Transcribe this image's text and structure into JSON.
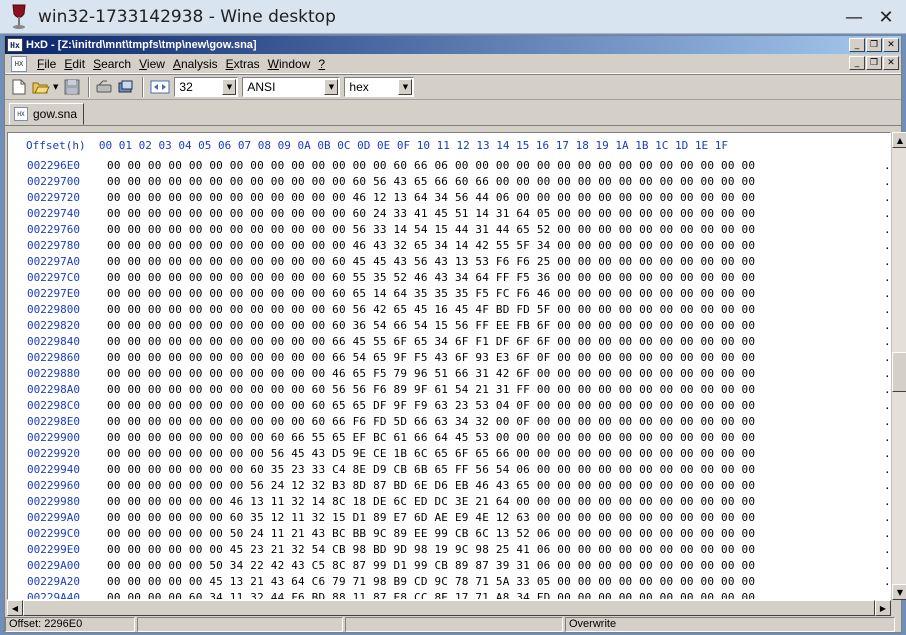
{
  "outer_window": {
    "title": "win32-1733142938 - Wine desktop"
  },
  "app": {
    "title": "HxD - [Z:\\initrd\\mnt\\tmpfs\\tmp\\new\\gow.sna]",
    "menu": [
      {
        "label": "File",
        "ul": "F",
        "rest": "ile"
      },
      {
        "label": "Edit",
        "ul": "E",
        "rest": "dit"
      },
      {
        "label": "Search",
        "ul": "S",
        "rest": "earch"
      },
      {
        "label": "View",
        "ul": "V",
        "rest": "iew"
      },
      {
        "label": "Analysis",
        "ul": "A",
        "rest": "nalysis"
      },
      {
        "label": "Extras",
        "ul": "E",
        "rest": "xtras"
      },
      {
        "label": "Window",
        "ul": "W",
        "rest": "indow"
      },
      {
        "label": "?",
        "ul": "?",
        "rest": ""
      }
    ],
    "toolbar": {
      "bytes_per_row": "32",
      "charset": "ANSI",
      "offset_base": "hex"
    },
    "tab": {
      "label": "gow.sna"
    },
    "hex_header": "Offset(h)  00 01 02 03 04 05 06 07 08 09 0A 0B 0C 0D 0E 0F 10 11 12 13 14 15 16 17 18 19 1A 1B 1C 1D 1E 1F",
    "rows": [
      {
        "offset": "002296E0",
        "bytes": "00 00 00 00 00 00 00 00 00 00 00 00 00 00 60 66 06 00 00 00 00 00 00 00 00 00 00 00 00 00 00 00",
        "ascii": "."
      },
      {
        "offset": "00229700",
        "bytes": "00 00 00 00 00 00 00 00 00 00 00 00 60 56 43 65 66 60 66 00 00 00 00 00 00 00 00 00 00 00 00 00",
        "ascii": "."
      },
      {
        "offset": "00229720",
        "bytes": "00 00 00 00 00 00 00 00 00 00 00 00 46 12 13 64 34 56 44 06 00 00 00 00 00 00 00 00 00 00 00 00",
        "ascii": "."
      },
      {
        "offset": "00229740",
        "bytes": "00 00 00 00 00 00 00 00 00 00 00 00 60 24 33 41 45 51 14 31 64 05 00 00 00 00 00 00 00 00 00 00",
        "ascii": "."
      },
      {
        "offset": "00229760",
        "bytes": "00 00 00 00 00 00 00 00 00 00 00 00 56 33 14 54 15 44 31 44 65 52 00 00 00 00 00 00 00 00 00 00",
        "ascii": "."
      },
      {
        "offset": "00229780",
        "bytes": "00 00 00 00 00 00 00 00 00 00 00 00 46 43 32 65 34 14 42 55 5F 34 00 00 00 00 00 00 00 00 00 00",
        "ascii": "."
      },
      {
        "offset": "002297A0",
        "bytes": "00 00 00 00 00 00 00 00 00 00 00 60 45 45 43 56 43 13 53 F6 F6 25 00 00 00 00 00 00 00 00 00 00",
        "ascii": "."
      },
      {
        "offset": "002297C0",
        "bytes": "00 00 00 00 00 00 00 00 00 00 00 60 55 35 52 46 43 34 64 FF F5 36 00 00 00 00 00 00 00 00 00 00",
        "ascii": "."
      },
      {
        "offset": "002297E0",
        "bytes": "00 00 00 00 00 00 00 00 00 00 00 60 65 14 64 35 35 35 F5 FC F6 46 00 00 00 00 00 00 00 00 00 00",
        "ascii": "."
      },
      {
        "offset": "00229800",
        "bytes": "00 00 00 00 00 00 00 00 00 00 00 60 56 42 65 45 16 45 4F BD FD 5F 00 00 00 00 00 00 00 00 00 00",
        "ascii": "."
      },
      {
        "offset": "00229820",
        "bytes": "00 00 00 00 00 00 00 00 00 00 00 60 36 54 66 54 15 56 FF EE FB 6F 00 00 00 00 00 00 00 00 00 00",
        "ascii": "."
      },
      {
        "offset": "00229840",
        "bytes": "00 00 00 00 00 00 00 00 00 00 00 66 45 55 6F 65 34 6F F1 DF 6F 6F 00 00 00 00 00 00 00 00 00 00",
        "ascii": "."
      },
      {
        "offset": "00229860",
        "bytes": "00 00 00 00 00 00 00 00 00 00 00 66 54 65 9F F5 43 6F 93 E3 6F 0F 00 00 00 00 00 00 00 00 00 00",
        "ascii": "."
      },
      {
        "offset": "00229880",
        "bytes": "00 00 00 00 00 00 00 00 00 00 00 46 65 F5 79 96 51 66 31 42 6F 00 00 00 00 00 00 00 00 00 00 00",
        "ascii": "."
      },
      {
        "offset": "002298A0",
        "bytes": "00 00 00 00 00 00 00 00 00 00 60 56 56 F6 89 9F 61 54 21 31 FF 00 00 00 00 00 00 00 00 00 00 00",
        "ascii": "."
      },
      {
        "offset": "002298C0",
        "bytes": "00 00 00 00 00 00 00 00 00 00 60 65 65 DF 9F F9 63 23 53 04 0F 00 00 00 00 00 00 00 00 00 00 00",
        "ascii": "."
      },
      {
        "offset": "002298E0",
        "bytes": "00 00 00 00 00 00 00 00 00 00 60 66 F6 FD 5D 66 63 34 32 00 0F 00 00 00 00 00 00 00 00 00 00 00",
        "ascii": "."
      },
      {
        "offset": "00229900",
        "bytes": "00 00 00 00 00 00 00 00 60 66 55 65 EF BC 61 66 64 45 53 00 00 00 00 00 00 00 00 00 00 00 00 00",
        "ascii": "."
      },
      {
        "offset": "00229920",
        "bytes": "00 00 00 00 00 00 00 00 56 45 43 D5 9E CE 1B 6C 65 6F 65 66 00 00 00 00 00 00 00 00 00 00 00 00",
        "ascii": "."
      },
      {
        "offset": "00229940",
        "bytes": "00 00 00 00 00 00 00 60 35 23 33 C4 8E D9 CB 6B 65 FF 56 54 06 00 00 00 00 00 00 00 00 00 00 00",
        "ascii": "."
      },
      {
        "offset": "00229960",
        "bytes": "00 00 00 00 00 00 00 56 24 12 32 B3 8D 87 BD 6E D6 EB 46 43 65 00 00 00 00 00 00 00 00 00 00 00",
        "ascii": "."
      },
      {
        "offset": "00229980",
        "bytes": "00 00 00 00 00 00 46 13 11 32 14 8C 18 DE 6C ED DC 3E 21 64 00 00 00 00 00 00 00 00 00 00 00 00",
        "ascii": "."
      },
      {
        "offset": "002299A0",
        "bytes": "00 00 00 00 00 00 60 35 12 11 32 15 D1 89 E7 6D AE E9 4E 12 63 00 00 00 00 00 00 00 00 00 00 00",
        "ascii": "."
      },
      {
        "offset": "002299C0",
        "bytes": "00 00 00 00 00 00 50 24 11 21 43 BC BB 9C 89 EE 99 CB 6C 13 52 06 00 00 00 00 00 00 00 00 00 00",
        "ascii": "."
      },
      {
        "offset": "002299E0",
        "bytes": "00 00 00 00 00 00 45 23 21 32 54 CB 98 BD 9D 98 19 9C 98 25 41 06 00 00 00 00 00 00 00 00 00 00",
        "ascii": "."
      },
      {
        "offset": "00229A00",
        "bytes": "00 00 00 00 00 50 34 22 42 43 C5 8C 87 99 D1 99 CB 89 87 39 31 06 00 00 00 00 00 00 00 00 00 00",
        "ascii": "."
      },
      {
        "offset": "00229A20",
        "bytes": "00 00 00 00 00 45 13 21 43 64 C6 79 71 98 B9 CD 9C 78 71 5A 33 05 00 00 00 00 00 00 00 00 00 00",
        "ascii": "."
      },
      {
        "offset": "00229A40",
        "bytes": "00 00 00 00 60 34 11 32 44 F6 BD 88 11 87 E8 CC 8E 17 71 A8 34 ED 00 00 00 00 00 00 00 00 00 00",
        "ascii": "."
      }
    ],
    "status": {
      "offset": "Offset: 2296E0",
      "mode": "Overwrite"
    }
  }
}
